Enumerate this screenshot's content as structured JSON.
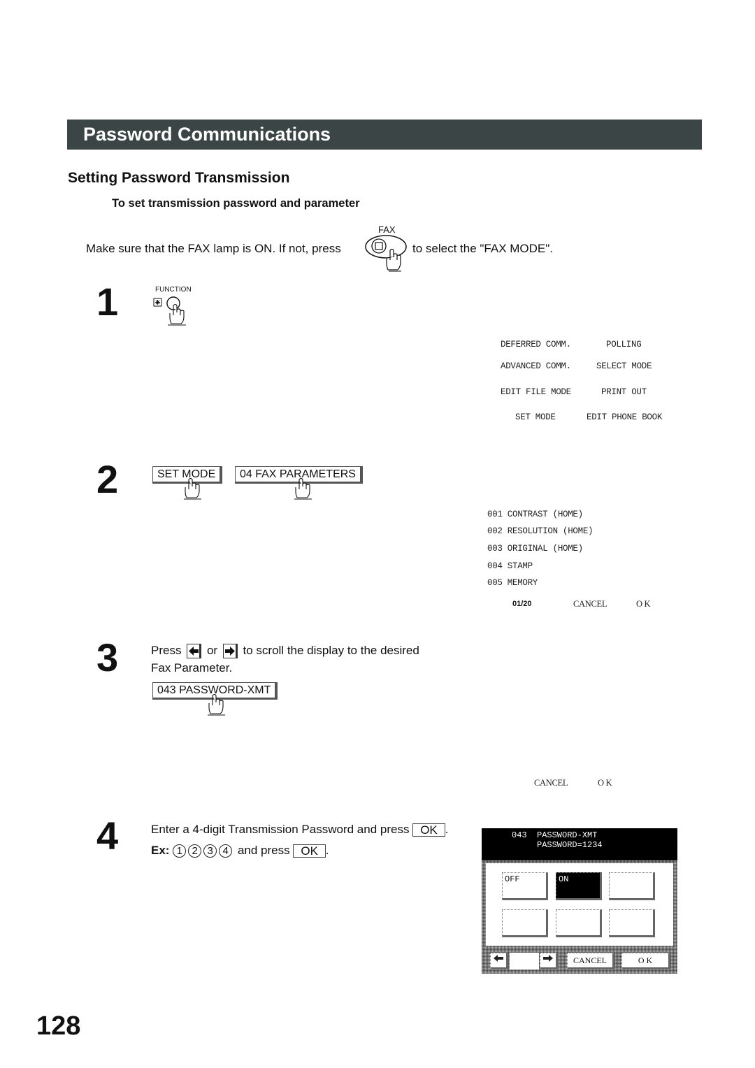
{
  "header": {
    "title": "Password Communications"
  },
  "section_title": "Setting  Password Transmission",
  "sub_title": "To set transmission password and parameter",
  "intro": {
    "text_before": "Make sure that the FAX lamp is ON.  If not, press",
    "fax_key_label": "FAX",
    "text_after": "to select the \"FAX MODE\"."
  },
  "steps": [
    {
      "number": "1",
      "key_label": "FUNCTION",
      "lcd_menu": [
        [
          "DEFERRED COMM.",
          "POLLING"
        ],
        [
          "ADVANCED COMM.",
          "SELECT MODE"
        ],
        [
          "EDIT FILE MODE",
          "PRINT OUT"
        ],
        [
          "SET MODE",
          "EDIT PHONE BOOK"
        ]
      ]
    },
    {
      "number": "2",
      "buttons": [
        "SET MODE",
        "04 FAX PARAMETERS"
      ],
      "lcd_list": [
        "001 CONTRAST (HOME)",
        "002 RESOLUTION (HOME)",
        "003 ORIGINAL (HOME)",
        "004 STAMP",
        "005 MEMORY"
      ],
      "lcd_page": "01/20",
      "lcd_cancel": "CANCEL",
      "lcd_ok": "O K"
    },
    {
      "number": "3",
      "text_press": "Press",
      "text_or": "or",
      "text_rest": "to scroll the display to the desired",
      "text_line2": "Fax Parameter.",
      "button": "043 PASSWORD-XMT",
      "lcd_cancel": "CANCEL",
      "lcd_ok": "O K"
    },
    {
      "number": "4",
      "line1": "Enter a 4-digit Transmission Password and press",
      "ok_label": "OK",
      "ex_label": "Ex:",
      "digits": [
        "1",
        "2",
        "3",
        "4"
      ],
      "line2_rest": "and press",
      "period": ".",
      "panel": {
        "screen_line1": "043  PASSWORD-XMT",
        "screen_line2": "     PASSWORD=1234",
        "buttons": [
          "OFF",
          "ON",
          "",
          "",
          "",
          ""
        ],
        "selected": "ON",
        "cancel": "CANCEL",
        "ok": "O K"
      }
    }
  ],
  "page_number": "128"
}
